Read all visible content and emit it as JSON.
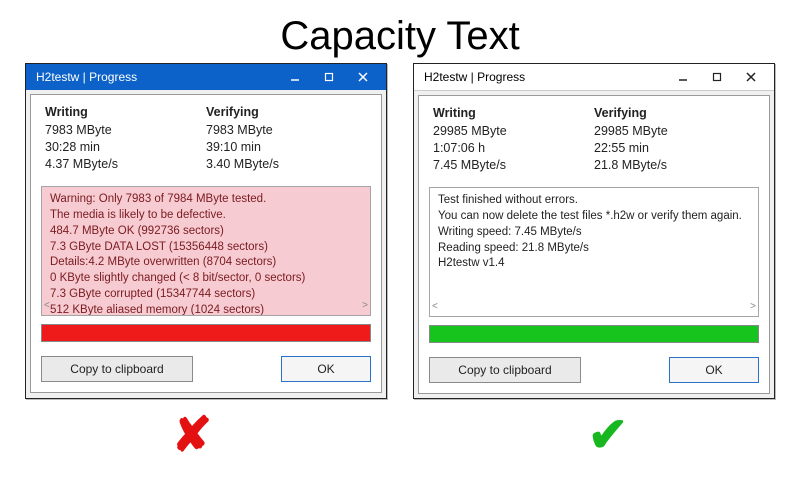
{
  "pageTitle": "Capacity Text",
  "left": {
    "title": "H2testw | Progress",
    "stats": {
      "writing": {
        "header": "Writing",
        "bytes": "7983 MByte",
        "time": "30:28 min",
        "rate": "4.37 MByte/s"
      },
      "verifying": {
        "header": "Verifying",
        "bytes": "7983 MByte",
        "time": "39:10 min",
        "rate": "3.40 MByte/s"
      }
    },
    "log": [
      "Warning: Only 7983 of 7984 MByte tested.",
      "The media is likely to be defective.",
      "484.7 MByte OK (992736 sectors)",
      "7.3 GByte DATA LOST (15356448 sectors)",
      "Details:4.2 MByte overwritten (8704 sectors)",
      "0 KByte slightly changed (< 8 bit/sector, 0 sectors)",
      "7.3 GByte corrupted (15347744 sectors)",
      "512 KByte aliased memory (1024 sectors)"
    ],
    "buttons": {
      "copy": "Copy to clipboard",
      "ok": "OK"
    },
    "mark": "✘"
  },
  "right": {
    "title": "H2testw | Progress",
    "stats": {
      "writing": {
        "header": "Writing",
        "bytes": "29985 MByte",
        "time": "1:07:06 h",
        "rate": "7.45 MByte/s"
      },
      "verifying": {
        "header": "Verifying",
        "bytes": "29985 MByte",
        "time": "22:55 min",
        "rate": "21.8 MByte/s"
      }
    },
    "log": [
      "Test finished without errors.",
      "You can now delete the test files *.h2w or verify them again.",
      "Writing speed: 7.45 MByte/s",
      "Reading speed: 21.8 MByte/s",
      "H2testw v1.4"
    ],
    "buttons": {
      "copy": "Copy to clipboard",
      "ok": "OK"
    },
    "mark": "✔"
  },
  "colors": {
    "titlebarBlue": "#0c62c8",
    "barRed": "#ef1b1b",
    "barGreen": "#17c41d",
    "markRed": "#e31111",
    "markGreen": "#17b81f"
  }
}
